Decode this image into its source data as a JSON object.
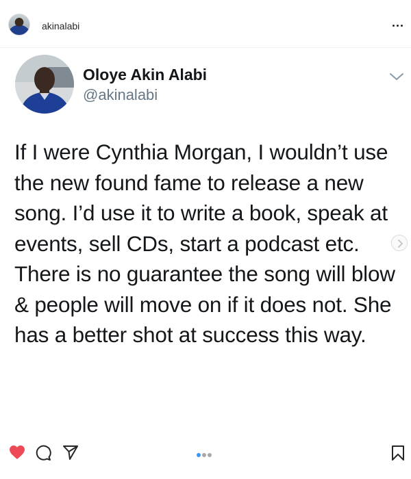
{
  "post": {
    "username": "akinalabi",
    "more_icon": "more-horizontal-icon"
  },
  "tweet": {
    "name": "Oloye Akin Alabi",
    "handle": "@akinalabi",
    "text": "If I were Cynthia Morgan, I wouldn’t use the new found fame to release a new song. I’d use it to write a book, speak at events, sell CDs, start a podcast etc. There is no guarantee the song will blow & people will move on if it does not. She has a better shot at success this way."
  },
  "actions": {
    "liked": true,
    "like_color": "#ed4956",
    "icons": [
      "heart-icon",
      "comment-icon",
      "share-icon",
      "save-icon"
    ]
  },
  "carousel": {
    "total": 3,
    "active": 1,
    "active_color": "#3897f0",
    "inactive_color": "#a8a8a8"
  }
}
